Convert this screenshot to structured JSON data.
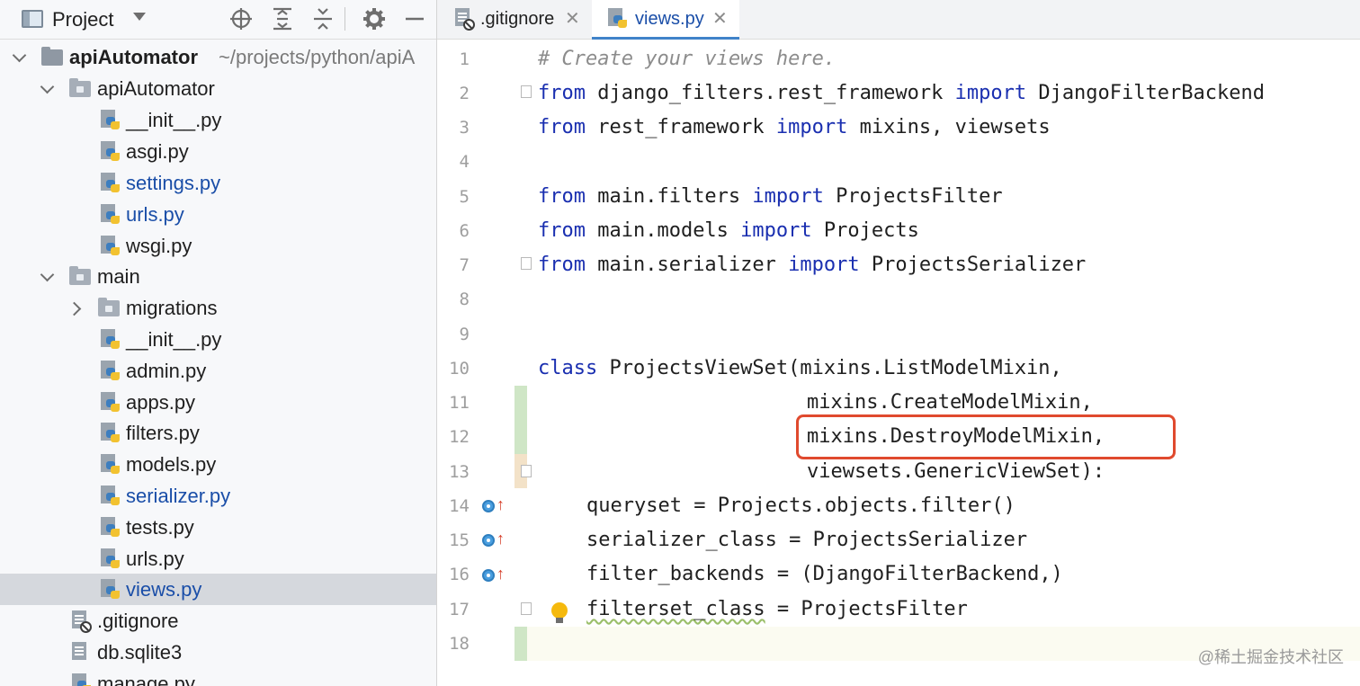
{
  "project_panel": {
    "title": "Project",
    "header_icons": [
      "locate-icon",
      "expand-all-icon",
      "collapse-all-icon",
      "gear-icon",
      "minimize-icon"
    ],
    "tree": [
      {
        "label": "apiAutomator",
        "path": "~/projects/python/apiA",
        "type": "root-folder",
        "expanded": true
      },
      {
        "label": "apiAutomator",
        "type": "folder",
        "expanded": true
      },
      {
        "label": "__init__.py",
        "type": "py"
      },
      {
        "label": "asgi.py",
        "type": "py"
      },
      {
        "label": "settings.py",
        "type": "py",
        "modified": true
      },
      {
        "label": "urls.py",
        "type": "py",
        "modified": true
      },
      {
        "label": "wsgi.py",
        "type": "py"
      },
      {
        "label": "main",
        "type": "folder",
        "expanded": true
      },
      {
        "label": "migrations",
        "type": "folder",
        "expanded": false
      },
      {
        "label": "__init__.py",
        "type": "py"
      },
      {
        "label": "admin.py",
        "type": "py"
      },
      {
        "label": "apps.py",
        "type": "py"
      },
      {
        "label": "filters.py",
        "type": "py"
      },
      {
        "label": "models.py",
        "type": "py"
      },
      {
        "label": "serializer.py",
        "type": "py",
        "modified": true
      },
      {
        "label": "tests.py",
        "type": "py"
      },
      {
        "label": "urls.py",
        "type": "py"
      },
      {
        "label": "views.py",
        "type": "py",
        "modified": true,
        "selected": true
      },
      {
        "label": ".gitignore",
        "type": "ignored-file"
      },
      {
        "label": "db.sqlite3",
        "type": "file"
      },
      {
        "label": "manage.py",
        "type": "py"
      }
    ]
  },
  "tabs": [
    {
      "label": ".gitignore",
      "active": false
    },
    {
      "label": "views.py",
      "active": true
    }
  ],
  "editor": {
    "line_numbers": [
      "1",
      "2",
      "3",
      "4",
      "5",
      "6",
      "7",
      "8",
      "9",
      "10",
      "11",
      "12",
      "13",
      "14",
      "15",
      "16",
      "17",
      "18"
    ],
    "lines": {
      "l1_comment": "# Create your views here.",
      "l2_from": "from",
      "l2_a": " django_filters.rest_framework ",
      "l2_import": "import",
      "l2_b": " DjangoFilterBackend",
      "l3_from": "from",
      "l3_a": " rest_framework ",
      "l3_import": "import",
      "l3_b": " mixins, viewsets",
      "l5_from": "from",
      "l5_a": " main.filters ",
      "l5_import": "import",
      "l5_b": " ProjectsFilter",
      "l6_from": "from",
      "l6_a": " main.models ",
      "l6_import": "import",
      "l6_b": " Projects",
      "l7_from": "from",
      "l7_a": " main.serializer ",
      "l7_import": "import",
      "l7_b": " ProjectsSerializer",
      "l10_class": "class",
      "l10_rest": " ProjectsViewSet(mixins.ListModelMixin,",
      "l11": "mixins.CreateModelMixin,",
      "l12": "mixins.DestroyModelMixin,",
      "l13": "viewsets.GenericViewSet):",
      "l14": "queryset = Projects.objects.filter()",
      "l15": "serializer_class = ProjectsSerializer",
      "l16": "filter_backends = (DjangoFilterBackend,)",
      "l17_a": "filterset_class",
      "l17_b": " = ProjectsFilter"
    },
    "gutter_icons": [
      "override-icon",
      "override-icon",
      "override-icon",
      "bulb-icon"
    ],
    "highlighted_line": "12"
  },
  "watermark": "@稀土掘金技术社区",
  "colors": {
    "keyword": "#1a2fb0",
    "comment": "#8c8c8c",
    "modified_file": "#1a4ea8",
    "highlight_box": "#e04a2e",
    "change_added": "#cfe6c6",
    "change_modified": "#f3e2c8",
    "selection": "#d5d8dd"
  }
}
